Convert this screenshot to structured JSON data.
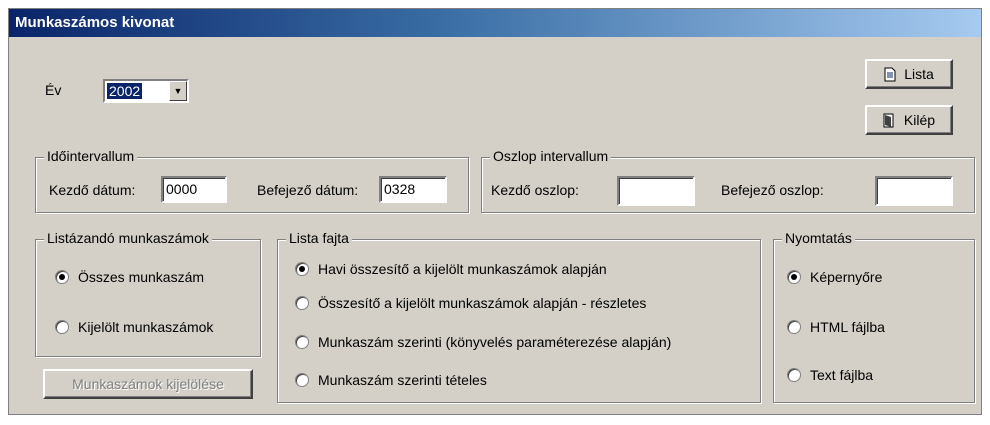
{
  "window": {
    "title": "Munkaszámos kivonat"
  },
  "year": {
    "label": "Év",
    "value": "2002"
  },
  "buttons": {
    "lista": "Lista",
    "kilep": "Kilép",
    "select_jobs": "Munkaszámok kijelölése"
  },
  "time_interval": {
    "legend": "Időintervallum",
    "start_label": "Kezdő dátum:",
    "start_value": "0000",
    "end_label": "Befejező dátum:",
    "end_value": "0328"
  },
  "column_interval": {
    "legend": "Oszlop intervallum",
    "start_label": "Kezdő oszlop:",
    "start_value": "",
    "end_label": "Befejező oszlop:",
    "end_value": ""
  },
  "jobs_group": {
    "legend": "Listázandó munkaszámok",
    "options": [
      {
        "label": "Összes munkaszám",
        "checked": true
      },
      {
        "label": "Kijelölt munkaszámok",
        "checked": false
      }
    ]
  },
  "list_type": {
    "legend": "Lista fajta",
    "options": [
      {
        "label": "Havi összesítő a kijelölt munkaszámok alapján",
        "checked": true
      },
      {
        "label": "Összesítő a kijelölt munkaszámok alapján - részletes",
        "checked": false
      },
      {
        "label": "Munkaszám szerinti (könyvelés paraméterezése alapján)",
        "checked": false
      },
      {
        "label": "Munkaszám szerinti tételes",
        "checked": false
      }
    ]
  },
  "print": {
    "legend": "Nyomtatás",
    "options": [
      {
        "label": "Képernyőre",
        "checked": true
      },
      {
        "label": "HTML fájlba",
        "checked": false
      },
      {
        "label": "Text fájlba",
        "checked": false
      }
    ]
  }
}
